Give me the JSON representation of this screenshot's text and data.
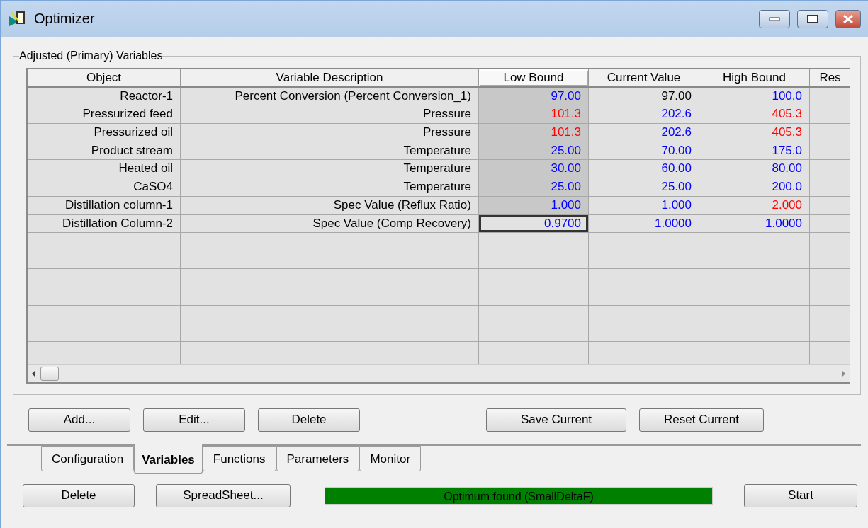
{
  "window": {
    "title": "Optimizer"
  },
  "group": {
    "title": "Adjusted (Primary) Variables"
  },
  "table": {
    "columns": [
      {
        "label": "Object",
        "selected": false
      },
      {
        "label": "Variable Description",
        "selected": false
      },
      {
        "label": "Low Bound",
        "selected": true
      },
      {
        "label": "Current Value",
        "selected": false
      },
      {
        "label": "High Bound",
        "selected": false
      },
      {
        "label": "Res",
        "selected": false
      }
    ],
    "rows": [
      {
        "object": "Reactor-1",
        "description": "Percent Conversion (Percent Conversion_1)",
        "values": [
          {
            "text": "97.00",
            "color": "#0000ff",
            "focused": false
          },
          {
            "text": "97.00",
            "color": "#000000",
            "focused": false
          },
          {
            "text": "100.0",
            "color": "#0000ff",
            "focused": false
          }
        ]
      },
      {
        "object": "Pressurized feed",
        "description": "Pressure",
        "values": [
          {
            "text": "101.3",
            "color": "#ff0000",
            "focused": false
          },
          {
            "text": "202.6",
            "color": "#0000ff",
            "focused": false
          },
          {
            "text": "405.3",
            "color": "#ff0000",
            "focused": false
          }
        ]
      },
      {
        "object": "Pressurized oil",
        "description": "Pressure",
        "values": [
          {
            "text": "101.3",
            "color": "#ff0000",
            "focused": false
          },
          {
            "text": "202.6",
            "color": "#0000ff",
            "focused": false
          },
          {
            "text": "405.3",
            "color": "#ff0000",
            "focused": false
          }
        ]
      },
      {
        "object": "Product stream",
        "description": "Temperature",
        "values": [
          {
            "text": "25.00",
            "color": "#0000ff",
            "focused": false
          },
          {
            "text": "70.00",
            "color": "#0000ff",
            "focused": false
          },
          {
            "text": "175.0",
            "color": "#0000ff",
            "focused": false
          }
        ]
      },
      {
        "object": "Heated oil",
        "description": "Temperature",
        "values": [
          {
            "text": "30.00",
            "color": "#0000ff",
            "focused": false
          },
          {
            "text": "60.00",
            "color": "#0000ff",
            "focused": false
          },
          {
            "text": "80.00",
            "color": "#0000ff",
            "focused": false
          }
        ]
      },
      {
        "object": "CaSO4",
        "description": "Temperature",
        "values": [
          {
            "text": "25.00",
            "color": "#0000ff",
            "focused": false
          },
          {
            "text": "25.00",
            "color": "#0000ff",
            "focused": false
          },
          {
            "text": "200.0",
            "color": "#0000ff",
            "focused": false
          }
        ]
      },
      {
        "object": "Distillation column-1",
        "description": "Spec Value (Reflux Ratio)",
        "values": [
          {
            "text": "1.000",
            "color": "#0000ff",
            "focused": false
          },
          {
            "text": "1.000",
            "color": "#0000ff",
            "focused": false
          },
          {
            "text": "2.000",
            "color": "#ff0000",
            "focused": false
          }
        ]
      },
      {
        "object": "Distillation Column-2",
        "description": "Spec Value (Comp Recovery)",
        "values": [
          {
            "text": "0.9700",
            "color": "#0000ff",
            "focused": true
          },
          {
            "text": "1.0000",
            "color": "#0000ff",
            "focused": false
          },
          {
            "text": "1.0000",
            "color": "#0000ff",
            "focused": false
          }
        ]
      }
    ]
  },
  "actions": [
    "Add...",
    "Edit...",
    "Delete",
    "Save Current",
    "Reset Current"
  ],
  "tabs": [
    {
      "label": "Configuration",
      "selected": false
    },
    {
      "label": "Variables",
      "selected": true
    },
    {
      "label": "Functions",
      "selected": false
    },
    {
      "label": "Parameters",
      "selected": false
    },
    {
      "label": "Monitor",
      "selected": false
    }
  ],
  "footer": {
    "buttons": [
      "Delete",
      "SpreadSheet..."
    ],
    "status": "Optimum found (SmallDeltaF)",
    "start": "Start"
  }
}
